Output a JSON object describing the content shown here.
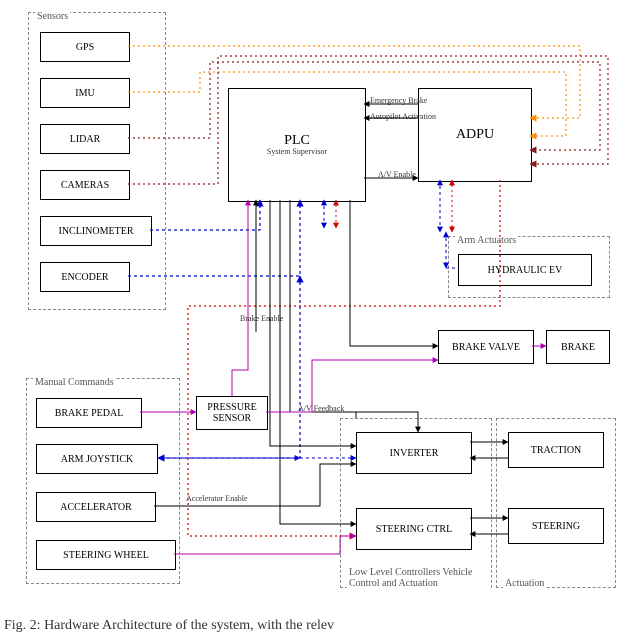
{
  "diagram_title": "Hardware Architecture",
  "groups": {
    "sensors": "Sensors",
    "manual_commands": "Manual Commands",
    "arm_actuators": "Arm Actuators",
    "low_level_controllers": "Low Level Controllers\nVehicle Control and Actuation",
    "actuation": "Actuation"
  },
  "blocks": {
    "gps": "GPS",
    "imu": "IMU",
    "lidar": "LIDAR",
    "cameras": "CAMERAS",
    "inclinometer": "INCLINOMETER",
    "encoder": "ENCODER",
    "plc": "PLC",
    "plc_sub": "System Supervisor",
    "adpu": "ADPU",
    "hydraulic_ev": "HYDRAULIC EV",
    "brake_valve": "BRAKE VALVE",
    "brake": "BRAKE",
    "brake_pedal": "BRAKE PEDAL",
    "pressure_sensor": "PRESSURE SENSOR",
    "arm_joystick": "ARM JOYSTICK",
    "accelerator": "ACCELERATOR",
    "steering_wheel": "STEERING WHEEL",
    "inverter": "INVERTER",
    "steering_ctrl": "STEERING CTRL",
    "traction": "TRACTION",
    "steering": "STEERING"
  },
  "annotations": {
    "emergency_brake": "Emergency Brake",
    "autopilot_activation": "Autopilot Activation",
    "av_enable": "A/V Enable",
    "brake_enable": "Brake Enable",
    "accelerator_enable": "Accelerator Enable",
    "av_feedback": "A/V Feedback"
  },
  "caption": "Fig. 2: Hardware Architecture of the system, with the relev",
  "colors": {
    "black": "#000000",
    "red": "#d00000",
    "blue": "#0000d0",
    "orange": "#ff9000",
    "darkred": "#8b1a1a",
    "magenta": "#b000b0",
    "gray": "#888888"
  }
}
